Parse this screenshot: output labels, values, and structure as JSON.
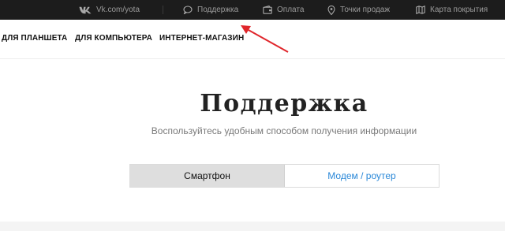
{
  "topbar": {
    "vk_link": "Vk.com/yota",
    "support": "Поддержка",
    "payment": "Оплата",
    "shops": "Точки продаж",
    "coverage_map": "Карта покрытия"
  },
  "nav": {
    "tablet": "ДЛЯ ПЛАНШЕТА",
    "computer": "ДЛЯ КОМПЬЮТЕРА",
    "shop": "ИНТЕРНЕТ-МАГАЗИН"
  },
  "main": {
    "title": "Поддержка",
    "subtitle": "Воспользуйтесь удобным способом получения информации"
  },
  "device_tabs": [
    {
      "label": "Смартфон",
      "active": true
    },
    {
      "label": "Модем / роутер",
      "active": false
    }
  ],
  "colors": {
    "topbar_bg": "#1c1c1c",
    "link_blue": "#2a88d8",
    "annotation_red": "#e0262b"
  },
  "icons": {
    "vk": "vk-logo-icon",
    "support": "chat-bubble-icon",
    "payment": "wallet-icon",
    "shops": "map-pin-icon",
    "coverage": "map-icon"
  }
}
